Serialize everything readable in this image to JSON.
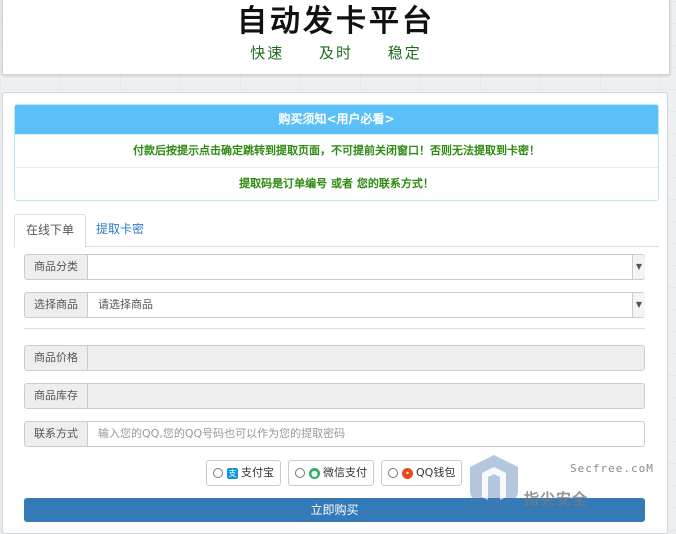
{
  "header": {
    "title": "自动发卡平台",
    "slogans": [
      "快速",
      "及时",
      "稳定"
    ]
  },
  "notice": {
    "heading": "购买须知<用户必看>",
    "line1": "付款后按提示点击确定跳转到提取页面，不可提前关闭窗口！否则无法提取到卡密！",
    "line2": "提取码是订单编号 或者 您的联系方式！"
  },
  "tabs": {
    "order": "在线下单",
    "extract": "提取卡密"
  },
  "form": {
    "category_label": "商品分类",
    "category_value": "",
    "product_label": "选择商品",
    "product_value": "请选择商品",
    "price_label": "商品价格",
    "price_value": "",
    "stock_label": "商品库存",
    "stock_value": "",
    "contact_label": "联系方式",
    "contact_placeholder": "输入您的QQ,您的QQ号码也可以作为您的提取密码"
  },
  "payment": {
    "alipay": "支付宝",
    "wechat": "微信支付",
    "qq": "QQ钱包"
  },
  "buy_button": "立即购买",
  "watermark": {
    "site": "Secfree.coM",
    "name": "指尖安全"
  },
  "colors": {
    "accent": "#337ab7",
    "notice_header": "#5bc0f8",
    "notice_text": "#2e8b12",
    "alipay": "#1296db",
    "wechat": "#2aae67",
    "qq": "#e8491d"
  }
}
